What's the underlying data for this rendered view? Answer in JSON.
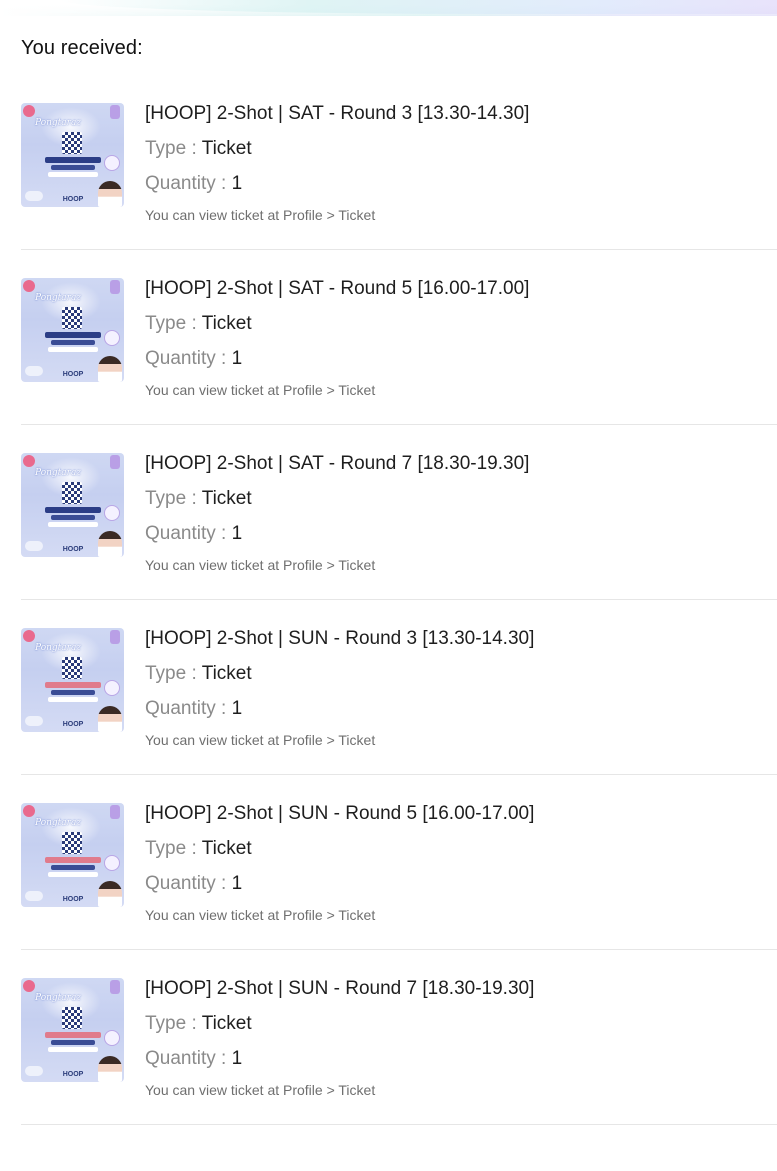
{
  "heading": "You received:",
  "type_label": "Type : ",
  "quantity_label": "Quantity : ",
  "items": [
    {
      "title": "[HOOP] 2-Shot | SAT - Round 3 [13.30-14.30]",
      "type": "Ticket",
      "quantity": "1",
      "note": "You can view ticket at Profile > Ticket",
      "day": "sat"
    },
    {
      "title": "[HOOP] 2-Shot | SAT - Round 5 [16.00-17.00]",
      "type": "Ticket",
      "quantity": "1",
      "note": "You can view ticket at Profile > Ticket",
      "day": "sat"
    },
    {
      "title": "[HOOP] 2-Shot | SAT - Round 7 [18.30-19.30]",
      "type": "Ticket",
      "quantity": "1",
      "note": "You can view ticket at Profile > Ticket",
      "day": "sat"
    },
    {
      "title": "[HOOP] 2-Shot | SUN - Round 3 [13.30-14.30]",
      "type": "Ticket",
      "quantity": "1",
      "note": "You can view ticket at Profile > Ticket",
      "day": "sun"
    },
    {
      "title": "[HOOP] 2-Shot | SUN - Round 5 [16.00-17.00]",
      "type": "Ticket",
      "quantity": "1",
      "note": "You can view ticket at Profile > Ticket",
      "day": "sun"
    },
    {
      "title": "[HOOP] 2-Shot | SUN - Round 7 [18.30-19.30]",
      "type": "Ticket",
      "quantity": "1",
      "note": "You can view ticket at Profile > Ticket",
      "day": "sun"
    }
  ],
  "thumbnail": {
    "icon": "ticket-poster-thumbnail",
    "brand_text": "HOOP"
  }
}
